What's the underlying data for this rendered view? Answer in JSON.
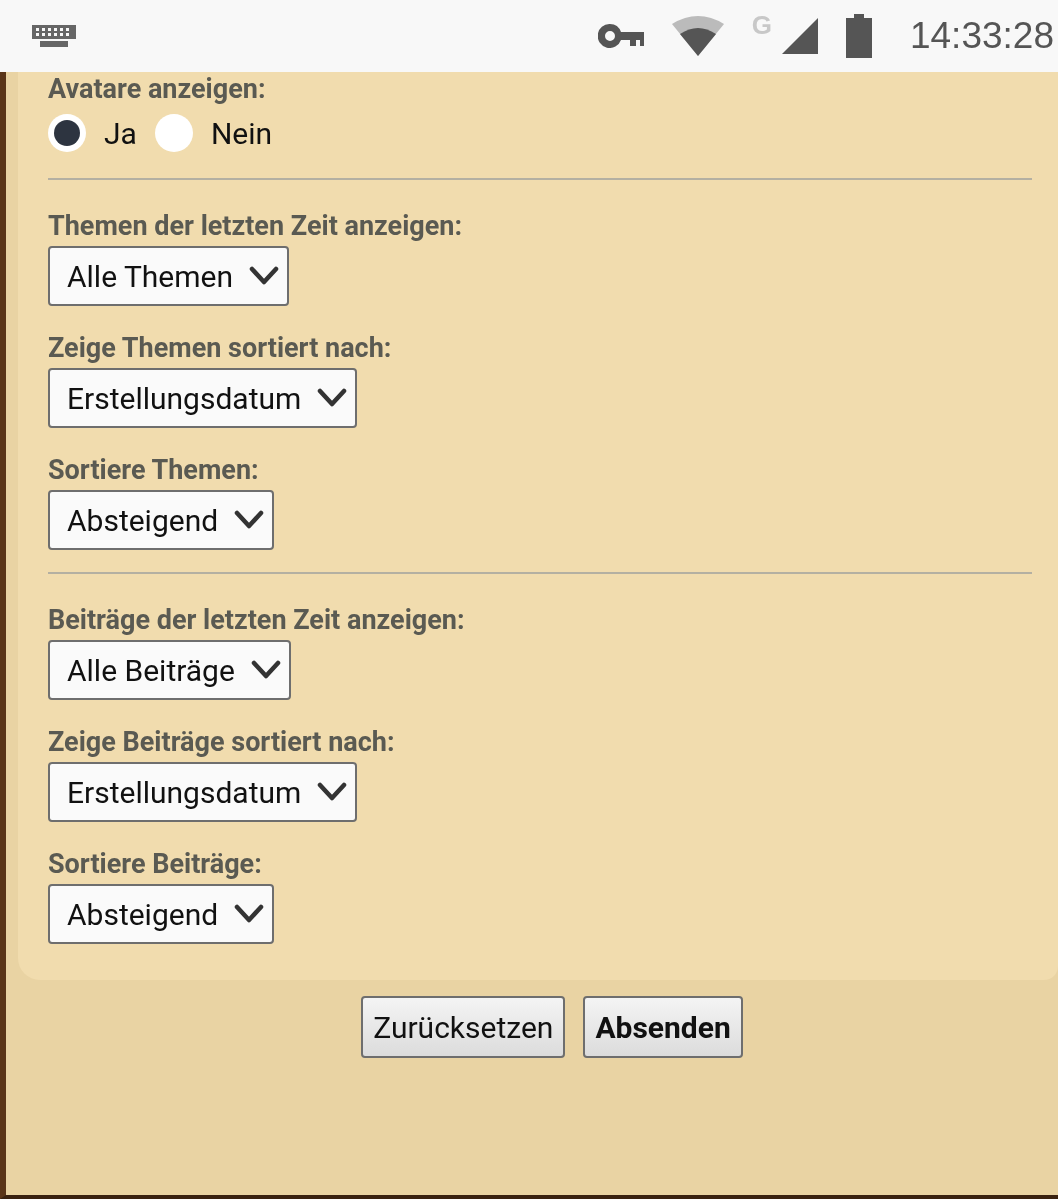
{
  "status_bar": {
    "network_label": "G",
    "time": "14:33:28"
  },
  "groups": [
    {
      "fields": [
        {
          "kind": "radio",
          "label": "Avatare anzeigen:",
          "options": [
            {
              "label": "Ja",
              "selected": true
            },
            {
              "label": "Nein",
              "selected": false
            }
          ]
        }
      ]
    },
    {
      "fields": [
        {
          "kind": "select",
          "label": "Themen der letzten Zeit anzeigen:",
          "value": "Alle Themen"
        },
        {
          "kind": "select",
          "label": "Zeige Themen sortiert nach:",
          "value": "Erstellungsdatum"
        },
        {
          "kind": "select",
          "label": "Sortiere Themen:",
          "value": "Absteigend"
        }
      ]
    },
    {
      "fields": [
        {
          "kind": "select",
          "label": "Beiträge der letzten Zeit anzeigen:",
          "value": "Alle Beiträge"
        },
        {
          "kind": "select",
          "label": "Zeige Beiträge sortiert nach:",
          "value": "Erstellungsdatum"
        },
        {
          "kind": "select",
          "label": "Sortiere Beiträge:",
          "value": "Absteigend"
        }
      ]
    }
  ],
  "buttons": [
    {
      "label": "Zurücksetzen",
      "primary": false
    },
    {
      "label": "Absenden",
      "primary": true
    }
  ]
}
